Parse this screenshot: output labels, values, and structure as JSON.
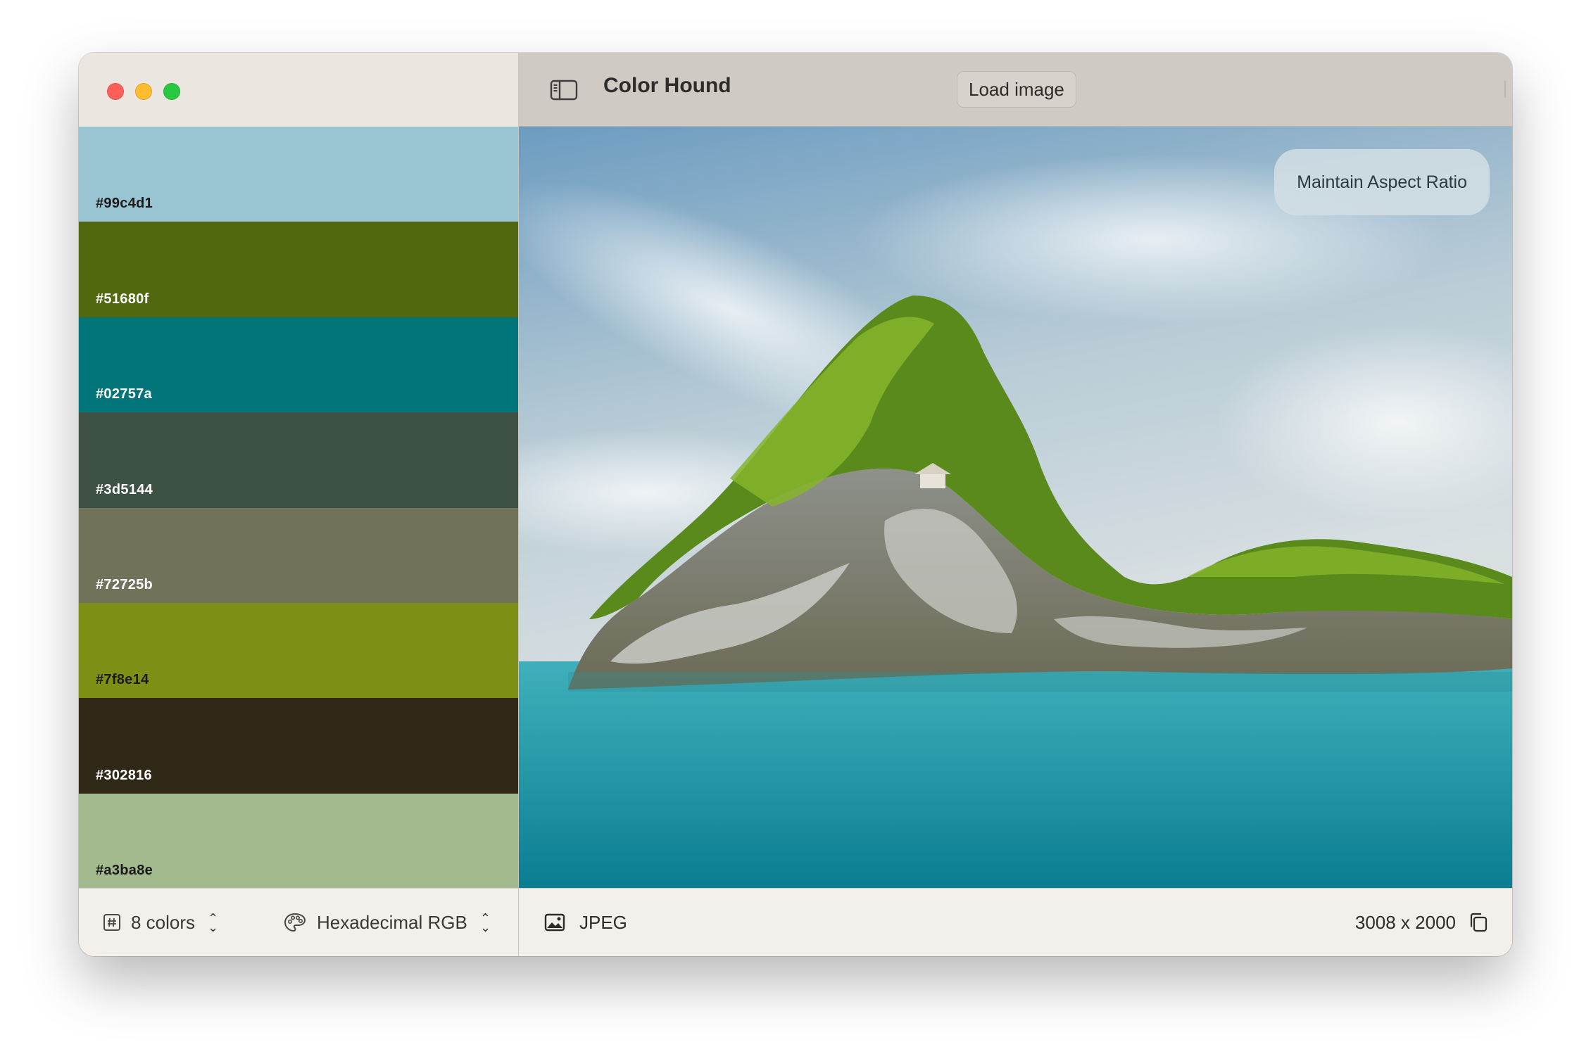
{
  "window": {
    "traffic_lights": [
      {
        "name": "close",
        "color": "#ff5f57"
      },
      {
        "name": "minimize",
        "color": "#febc2e"
      },
      {
        "name": "zoom",
        "color": "#28c840"
      }
    ]
  },
  "toolbar": {
    "sidebar_toggle_icon": "sidebar-left-icon",
    "title": "Color Hound",
    "load_button": "Load image",
    "share_icon": "share-icon"
  },
  "palette": {
    "swatches": [
      {
        "hex": "#99c4d1",
        "label": "#99c4d1",
        "text_color": "#1a1a1a"
      },
      {
        "hex": "#51680f",
        "label": "#51680f",
        "text_color": "#ffffff"
      },
      {
        "hex": "#02757a",
        "label": "#02757a",
        "text_color": "#ffffff"
      },
      {
        "hex": "#3d5144",
        "label": "#3d5144",
        "text_color": "#ffffff"
      },
      {
        "hex": "#72725b",
        "label": "#72725b",
        "text_color": "#ffffff"
      },
      {
        "hex": "#7f8e14",
        "label": "#7f8e14",
        "text_color": "#1a1a1a"
      },
      {
        "hex": "#302816",
        "label": "#302816",
        "text_color": "#ffffff"
      },
      {
        "hex": "#a3ba8e",
        "label": "#a3ba8e",
        "text_color": "#1a1a1a"
      }
    ]
  },
  "sidebar_footer": {
    "count_icon": "number-sign-icon",
    "count_label": "8 colors",
    "format_icon": "palette-icon",
    "format_label": "Hexadecimal RGB"
  },
  "image": {
    "aspect_button": "Maintain Aspect Ratio",
    "colors": {
      "sky_top": "#6c9cc0",
      "sky_mid": "#b9ccd6",
      "sky_light": "#d9e0e2",
      "sea_top": "#3fb0bb",
      "sea_bottom": "#0b7d91",
      "foliage": "#5b8a1c",
      "foliage_light": "#86b52a",
      "rock": "#8e918a",
      "rock_light": "#c9cbc5"
    }
  },
  "main_footer": {
    "format_icon": "photo-icon",
    "format_label": "JPEG",
    "dimensions": "3008 x 2000",
    "copy_icon": "copy-icon"
  }
}
